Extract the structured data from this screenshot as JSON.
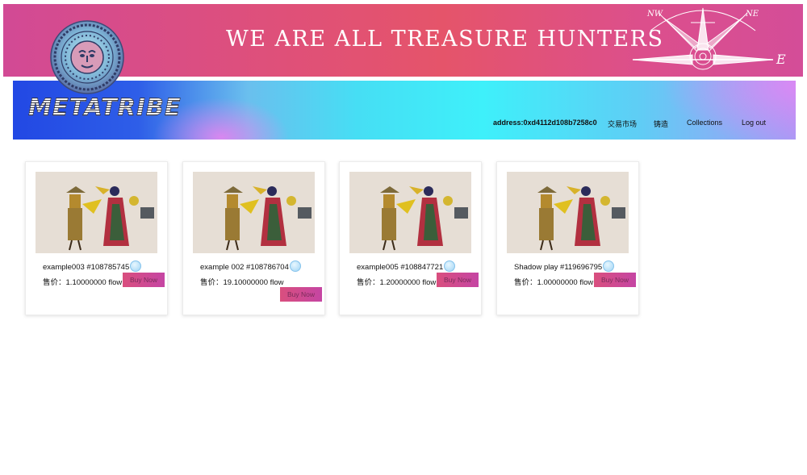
{
  "banner": {
    "title": "WE ARE ALL TREASURE HUNTERS",
    "compass_labels": {
      "nw": "NW",
      "ne": "NE",
      "e": "E"
    }
  },
  "nav": {
    "logo": "METATRIBE",
    "address": "address:0xd4112d108b7258c0",
    "market": "交易市场",
    "mint": "铸造",
    "collections": "Collections",
    "logout": "Log out"
  },
  "cards": [
    {
      "title": "example003 #108785745",
      "price_label": "售价：",
      "price": "1.10000000 flow",
      "button": "Buy Now"
    },
    {
      "title": "example 002 #108786704",
      "price_label": "售价：",
      "price": "19.10000000 flow",
      "button": "Buy Now"
    },
    {
      "title": "example005 #108847721",
      "price_label": "售价：",
      "price": "1.20000000 flow",
      "button": "Buy Now"
    },
    {
      "title": "Shadow play #119696795",
      "price_label": "售价：",
      "price": "1.00000000 flow",
      "button": "Buy Now"
    }
  ],
  "colors": {
    "banner": "#e05277",
    "buy_button": "#d94f7e",
    "nav_left": "#2248e4",
    "nav_center": "#3ef0fa",
    "nav_right": "#a79af5"
  },
  "icons": [
    "tribal-sun-emblem-icon",
    "compass-rose-icon",
    "flow-token-icon",
    "shadow-puppet-artwork"
  ]
}
